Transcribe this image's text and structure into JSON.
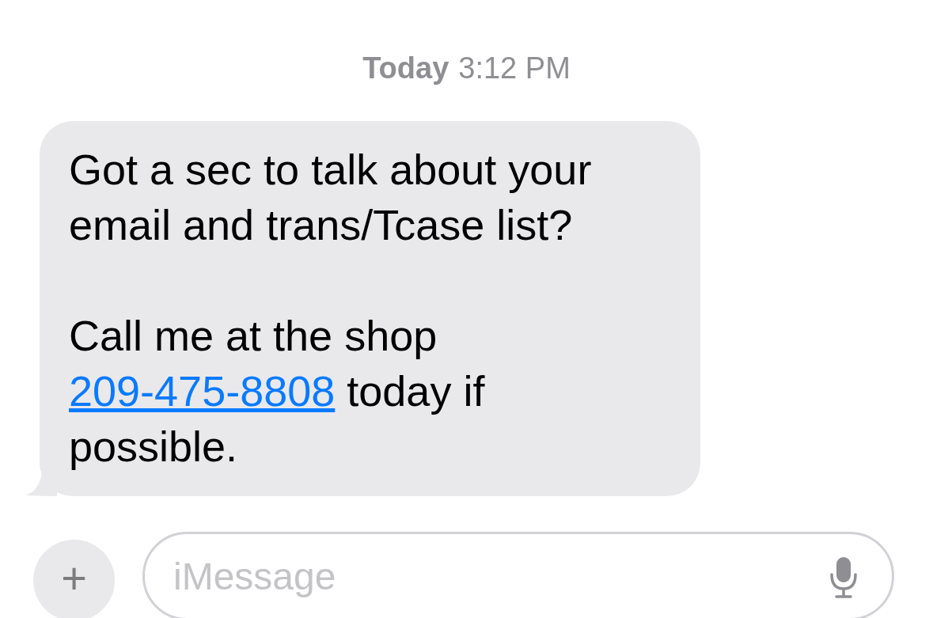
{
  "timestamp": {
    "day": "Today",
    "time": "3:12 PM"
  },
  "message": {
    "paragraphs": [
      {
        "text": "Got a sec to talk about your email and trans/Tcase list?"
      },
      {
        "text": "Call me at the shop",
        "link": "209-475-8808",
        "after": "today if possible."
      }
    ]
  },
  "composer": {
    "add": "+",
    "placeholder": "iMessage"
  }
}
